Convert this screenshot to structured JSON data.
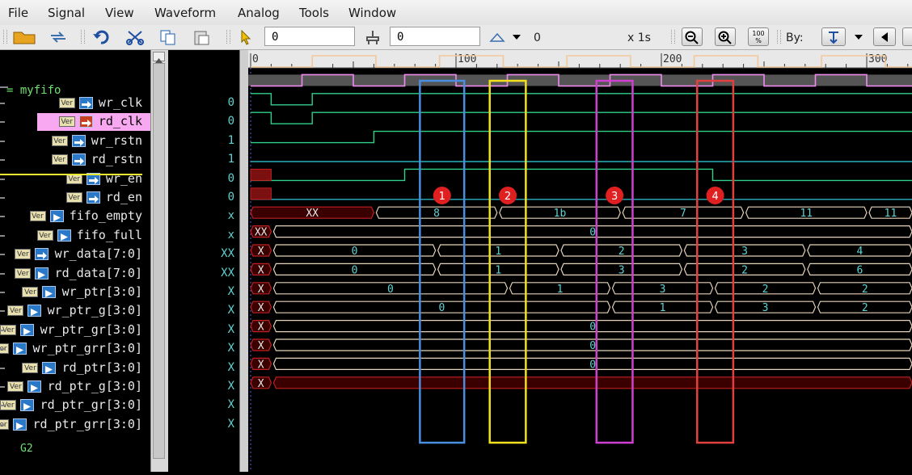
{
  "menu": [
    "File",
    "Signal",
    "View",
    "Waveform",
    "Analog",
    "Tools",
    "Window"
  ],
  "toolbar": {
    "time_value": "0",
    "cursor_value": "0",
    "delta_value": "0",
    "zoom_label": "x 1s",
    "zoom_100_label": "100 %",
    "by_label": "By:"
  },
  "tree": {
    "group": "= myfifo",
    "bottom": "G2"
  },
  "signals": [
    {
      "name": "wr_clk",
      "value": "0",
      "icon": "input-arrow-icon"
    },
    {
      "name": "rd_clk",
      "value": "0",
      "icon": "input-arrow-icon"
    },
    {
      "name": "wr_rstn",
      "value": "1",
      "icon": "input-arrow-icon"
    },
    {
      "name": "rd_rstn",
      "value": "1",
      "icon": "input-arrow-icon"
    },
    {
      "name": "wr_en",
      "value": "0",
      "icon": "input-arrow-icon"
    },
    {
      "name": "rd_en",
      "value": "0",
      "icon": "input-arrow-icon"
    },
    {
      "name": "fifo_empty",
      "value": "x",
      "icon": "output-arrow-icon"
    },
    {
      "name": "fifo_full",
      "value": "x",
      "icon": "output-arrow-icon"
    },
    {
      "name": "wr_data[7:0]",
      "value": "XX",
      "icon": "input-arrow-icon"
    },
    {
      "name": "rd_data[7:0]",
      "value": "XX",
      "icon": "output-arrow-icon"
    },
    {
      "name": "wr_ptr[3:0]",
      "value": "X",
      "icon": "output-arrow-icon"
    },
    {
      "name": "wr_ptr_g[3:0]",
      "value": "X",
      "icon": "output-arrow-icon"
    },
    {
      "name": "wr_ptr_gr[3:0]",
      "value": "X",
      "icon": "output-arrow-icon"
    },
    {
      "name": "wr_ptr_grr[3:0]",
      "value": "X",
      "icon": "output-arrow-icon"
    },
    {
      "name": "rd_ptr[3:0]",
      "value": "X",
      "icon": "output-arrow-icon"
    },
    {
      "name": "rd_ptr_g[3:0]",
      "value": "X",
      "icon": "output-arrow-icon"
    },
    {
      "name": "rd_ptr_gr[3:0]",
      "value": "X",
      "icon": "output-arrow-icon"
    },
    {
      "name": "rd_ptr_grr[3:0]",
      "value": "X",
      "icon": "output-arrow-icon"
    }
  ],
  "ruler": {
    "ticks": [
      "0",
      "100",
      "200",
      "300"
    ]
  },
  "bus_values": {
    "wr_data": [
      "XX",
      "8",
      "1b",
      "7",
      "11"
    ],
    "rd_data": [
      "XX",
      "0"
    ],
    "wr_ptr": [
      "X",
      "0",
      "1",
      "2",
      "3",
      "4"
    ],
    "wr_ptr_g": [
      "X",
      "0",
      "1",
      "3",
      "2",
      "6"
    ],
    "wr_ptr_gr": [
      "X",
      "0",
      "1",
      "3",
      "2"
    ],
    "wr_ptr_grr": [
      "X",
      "0",
      "1",
      "3",
      "2"
    ],
    "rd_ptr": [
      "X",
      "0"
    ],
    "rd_ptr_g": [
      "X",
      "0"
    ],
    "rd_ptr_gr": [
      "X",
      "0"
    ],
    "rd_ptr_grr": [
      "X"
    ]
  },
  "annotations": [
    {
      "label": "1",
      "color": "#4a8ee0"
    },
    {
      "label": "2",
      "color": "#f0e020"
    },
    {
      "label": "3",
      "color": "#d040d0"
    },
    {
      "label": "4",
      "color": "#e04040"
    }
  ],
  "colors": {
    "wr_clk": "#f2c89a",
    "rd_clk": "#ee8aee",
    "reset": "#2fd08a",
    "bus": "#e6d2b8",
    "value_text": "#5fd3d3",
    "xstate": "#c02020"
  }
}
